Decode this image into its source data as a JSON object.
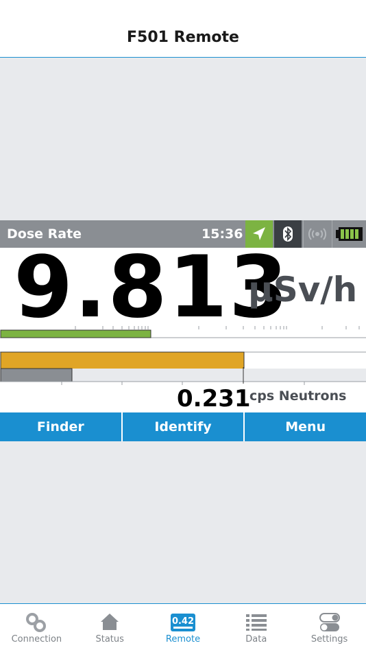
{
  "nav": {
    "title": "F501 Remote"
  },
  "device": {
    "status": {
      "mode": "Dose Rate",
      "time": "15:36",
      "gps_icon": "location-arrow-icon",
      "bluetooth_icon": "bluetooth-icon",
      "signal_icon": "wireless-signal-icon",
      "battery_icon": "battery-full-icon"
    },
    "dose_rate": {
      "value": "9.813",
      "unit": "µSv/h"
    },
    "gauges": {
      "gamma_level": 0.41,
      "dose_level": 0.665,
      "neutron_level": 0.195
    },
    "neutrons": {
      "value": "0.231",
      "unit": "cps Neutrons"
    },
    "softkeys": [
      "Finder",
      "Identify",
      "Menu"
    ]
  },
  "colors": {
    "accent": "#1a8fd0",
    "status_gray": "#8a8e93",
    "dose_bar": "#e0a526",
    "gamma_bar": "#7cb342",
    "neutron_bar": "#8a8e93"
  },
  "tabs": [
    {
      "label": "Connection",
      "icon": "link-icon",
      "active": false
    },
    {
      "label": "Status",
      "icon": "home-icon",
      "active": false
    },
    {
      "label": "Remote",
      "icon": "remote-display-icon",
      "badge": "0.42",
      "active": true
    },
    {
      "label": "Data",
      "icon": "list-icon",
      "active": false
    },
    {
      "label": "Settings",
      "icon": "toggle-icon",
      "active": false
    }
  ]
}
